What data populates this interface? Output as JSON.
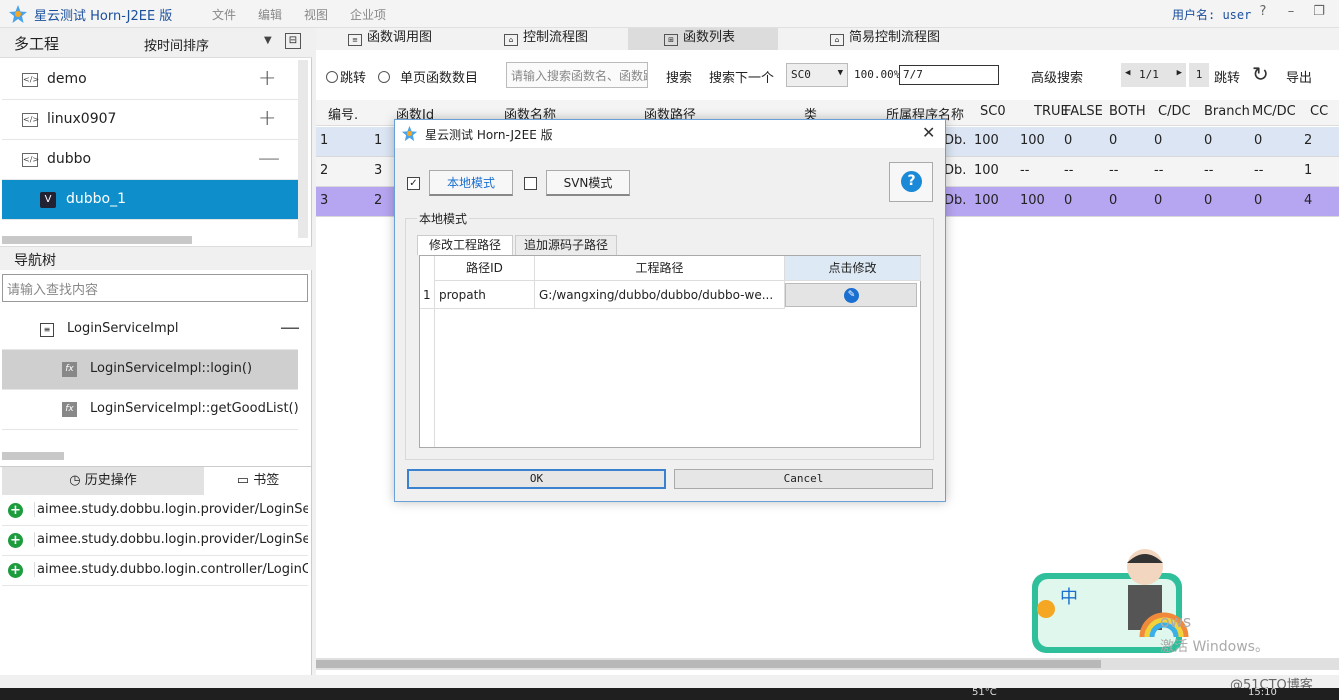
{
  "app": {
    "title": "星云测试 Horn-J2EE 版",
    "menu": [
      "文件",
      "编辑",
      "视图",
      "企业项"
    ],
    "user_label": "用户名: user",
    "window_buttons": [
      "?",
      "–",
      "❐",
      "✕"
    ]
  },
  "projects": {
    "title": "多工程",
    "sort_label": "按时间排序",
    "items": [
      {
        "label": "demo",
        "toggle": "+"
      },
      {
        "label": "linux0907",
        "toggle": "+"
      },
      {
        "label": "dubbo",
        "toggle": "—"
      }
    ],
    "selected_child": "dubbo_1"
  },
  "nav": {
    "title": "导航树",
    "search_placeholder": "请输入查找内容",
    "class_item": "LoginServiceImpl",
    "class_toggle": "—",
    "methods": [
      "LoginServiceImpl::login()",
      "LoginServiceImpl::getGoodList()"
    ]
  },
  "history": {
    "tab_active": "历史操作",
    "tab_other": "书签",
    "rows": [
      "aimee.study.dobbu.login.provider/LoginServi",
      "aimee.study.dobbu.login.provider/LoginServi",
      "aimee.study.dubbo.login.controller/LoginCon"
    ]
  },
  "main_tabs": [
    "函数调用图",
    "控制流程图",
    "函数列表",
    "简易控制流程图"
  ],
  "toolbar": {
    "jump_radio": "跳转",
    "single_page_radio": "单页函数数目",
    "search_placeholder": "请输入搜索函数名、函数路径",
    "search_btn": "搜索",
    "search_next_btn": "搜索下一个",
    "metric_select": "SC0",
    "percent": "100.00%",
    "range_value": "7/7",
    "advanced_search": "高级搜索",
    "page_indicator": "1/1",
    "page_input": "1",
    "jump_btn": "跳转",
    "export_btn": "导出"
  },
  "grid": {
    "headers": [
      "编号.",
      "函数Id",
      "函数名称",
      "函数路径",
      "类",
      "所属程序名称",
      "SC0",
      "TRUE",
      "FALSE",
      "BOTH",
      "C/DC",
      "Branch",
      "MC/DC",
      "CC"
    ],
    "rows": [
      {
        "no": "1",
        "id": "1",
        "prog": "Db.",
        "sc0": "100",
        "t": "100",
        "f": "0",
        "b": "0",
        "cdc": "0",
        "br": "0",
        "mcdc": "0",
        "cc": "2"
      },
      {
        "no": "2",
        "id": "3",
        "prog": "Db.",
        "sc0": "100",
        "t": "--",
        "f": "--",
        "b": "--",
        "cdc": "--",
        "br": "--",
        "mcdc": "--",
        "cc": "1"
      },
      {
        "no": "3",
        "id": "2",
        "prog": "Db.",
        "sc0": "100",
        "t": "100",
        "f": "0",
        "b": "0",
        "cdc": "0",
        "br": "0",
        "mcdc": "0",
        "cc": "4"
      }
    ]
  },
  "dialog": {
    "title": "星云测试 Horn-J2EE 版",
    "local_mode_btn": "本地模式",
    "svn_mode_btn": "SVN模式",
    "local_checked": true,
    "svn_checked": false,
    "group_title": "本地模式",
    "tab_active": "修改工程路径",
    "tab_other": "追加源码子路径",
    "columns": [
      "路径ID",
      "工程路径",
      "点击修改"
    ],
    "rows": [
      {
        "num": "1",
        "path_id": "propath",
        "path": "G:/wangxing/dubbo/dubbo/dubbo-we..."
      }
    ],
    "ok": "OK",
    "cancel": "Cancel"
  },
  "overlay": {
    "watermark": "@51CTO博客",
    "activate_line1": "ows",
    "activate_line2": "激活 Windows。",
    "taskbar_temp": "51°C",
    "taskbar_time": "15:10"
  },
  "colors": {
    "selection_blue": "#0e8fcc",
    "row_selected": "#b6a5f0",
    "row_alt": "#dbe5f3",
    "add_green": "#1c9c3c",
    "title_blue": "#1a4f9c"
  }
}
